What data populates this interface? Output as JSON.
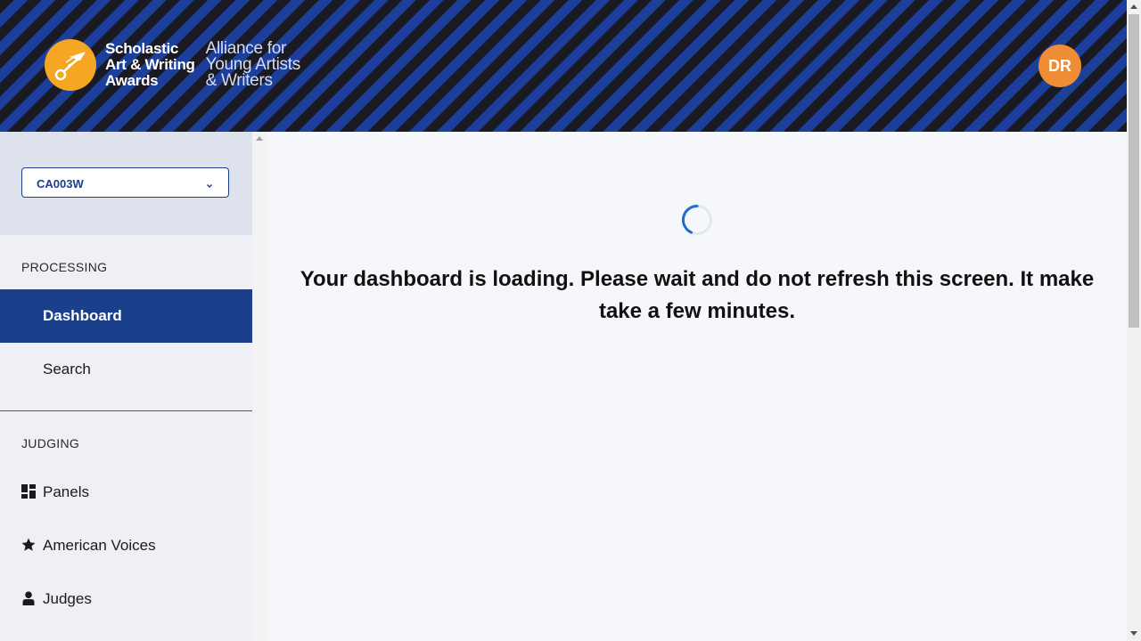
{
  "header": {
    "logo_name_lines": [
      "Scholastic",
      "Art & Writing",
      "Awards"
    ],
    "logo_tagline_lines": [
      "Alliance for",
      "Young Artists",
      "& Writers"
    ],
    "avatar_initials": "DR",
    "colors": {
      "stripe_dark": "#1a1a22",
      "stripe_blue": "#1c3f9c",
      "logo": "#f5a623",
      "avatar": "#ee8d35"
    }
  },
  "sidebar": {
    "org_select": {
      "value": "CA003W"
    },
    "sections": [
      {
        "label": "PROCESSING",
        "items": [
          {
            "label": "Dashboard",
            "active": true
          },
          {
            "label": "Search",
            "active": false
          }
        ]
      },
      {
        "label": "JUDGING",
        "items": [
          {
            "label": "Panels",
            "icon": "grid-icon"
          },
          {
            "label": "American Voices",
            "icon": "star-icon"
          },
          {
            "label": "Judges",
            "icon": "person-icon"
          }
        ]
      }
    ],
    "colors": {
      "active_bg": "#1a3f8b"
    }
  },
  "main": {
    "loading_message": "Your dashboard is loading. Please wait and do not refresh this screen. It make take a few minutes."
  }
}
